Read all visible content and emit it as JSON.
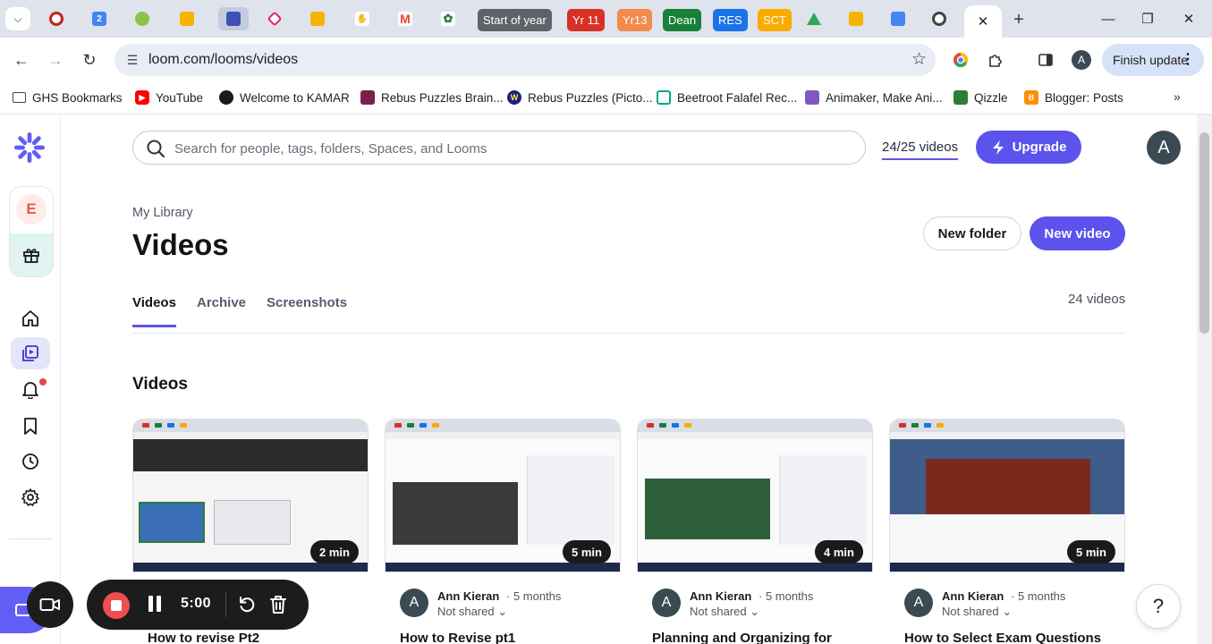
{
  "browser": {
    "group_chips": [
      {
        "label": "Start of year",
        "color": "#5f6368"
      },
      {
        "label": "Yr 11",
        "color": "#d93025"
      },
      {
        "label": "Yr13",
        "color": "#f28b4b"
      },
      {
        "label": "Dean",
        "color": "#188038"
      },
      {
        "label": "RES",
        "color": "#1a73e8"
      },
      {
        "label": "SCT",
        "color": "#f9ab00"
      }
    ],
    "url": "loom.com/looms/videos",
    "finish_update": "Finish update",
    "profile_letter": "A",
    "bookmarks": [
      "GHS Bookmarks",
      "YouTube",
      "Welcome to KAMAR",
      "Rebus Puzzles Brain...",
      "Rebus Puzzles (Picto...",
      "Beetroot Falafel Rec...",
      "Animaker, Make Ani...",
      "Qizzle",
      "Blogger: Posts"
    ]
  },
  "sidebar": {
    "workspace_letter": "E",
    "accent": "#625df5"
  },
  "header": {
    "search_placeholder": "Search for people, tags, folders, Spaces, and Looms",
    "quota": "24/25 videos",
    "upgrade_label": "Upgrade",
    "avatar_letter": "A"
  },
  "page": {
    "breadcrumb": "My Library",
    "title": "Videos",
    "new_folder": "New folder",
    "new_video": "New video",
    "tabs": [
      "Videos",
      "Archive",
      "Screenshots"
    ],
    "video_count": "24 videos",
    "section_title": "Videos"
  },
  "videos": [
    {
      "duration": "2 min",
      "owner": "",
      "age": "",
      "share": "",
      "title": "How to revise Pt2"
    },
    {
      "duration": "5 min",
      "owner": "Ann Kieran",
      "age": "· 5 months",
      "share": "Not shared",
      "title": "How to Revise pt1"
    },
    {
      "duration": "4 min",
      "owner": "Ann Kieran",
      "age": "· 5 months",
      "share": "Not shared",
      "title": "Planning and Organizing for"
    },
    {
      "duration": "5 min",
      "owner": "Ann Kieran",
      "age": "· 5 months",
      "share": "Not shared",
      "title": "How to Select Exam Questions"
    }
  ],
  "recorder": {
    "time": "5:00"
  },
  "help_label": "?"
}
